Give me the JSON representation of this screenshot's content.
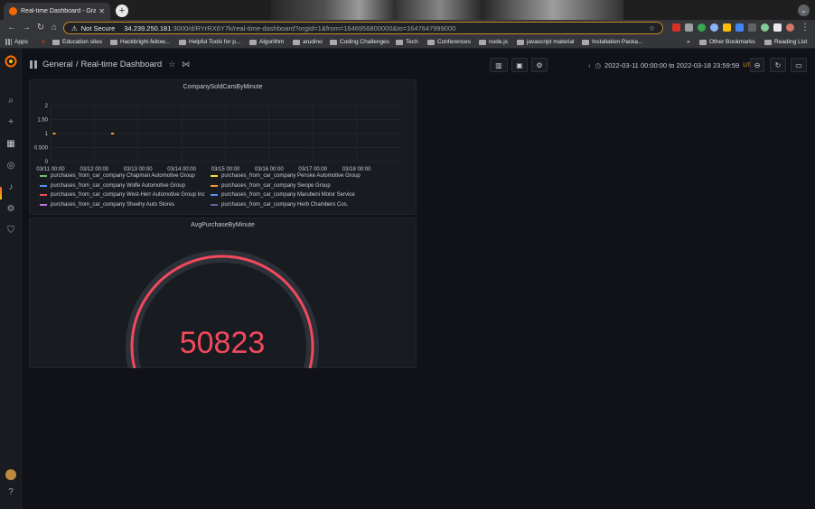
{
  "browser": {
    "tab_title": "Real-time Dashboard - Grafan",
    "tab_close": "✕",
    "new_tab": "+",
    "security": "Not Secure",
    "url_host": "34.239.250.181",
    "url_path": ":3000/d/RYrRX6Y7k/real-time-dashboard?orgId=1&from=1646956800000&to=1647647999000",
    "bookmarks": [
      "Apps",
      "Education sites",
      "Hackbright-fellow...",
      "Helpful Tools for p...",
      "Algorithm",
      "arudino",
      "Coding Challenges",
      "Tech",
      "Conferences",
      "node.js",
      "javascript material",
      "Installation Packa..."
    ],
    "bookmarks_more": "»",
    "other_bookmarks": "Other Bookmarks",
    "reading_list": "Reading List"
  },
  "dashboard": {
    "folder": "General",
    "separator": "/",
    "title": "Real-time Dashboard",
    "time_range": "2022-03-11 00:00:00 to 2022-03-18 23:59:59",
    "timezone": "UTC"
  },
  "panels": {
    "cars": {
      "title": "CompanySoldCarsByMinute"
    },
    "gauge": {
      "title": "AvgPurchaseByMinute",
      "value": "50823",
      "fill_fraction": 1.0,
      "color": "#f2495c"
    }
  },
  "chart_data": {
    "type": "scatter",
    "title": "CompanySoldCarsByMinute",
    "x_ticks": [
      "03/11 00:00",
      "03/12 00:00",
      "03/13 00:00",
      "03/14 00:00",
      "03/15 00:00",
      "03/16 00:00",
      "03/17 00:00",
      "03/18 00:00"
    ],
    "y_ticks": [
      "0",
      "0.500",
      "1",
      "1.50",
      "2"
    ],
    "ylim": [
      0,
      2
    ],
    "grid": true,
    "legend_position": "bottom",
    "series": [
      {
        "name": "purchases_from_car_company Chapman Automotive Group",
        "color": "#73bf69",
        "points": [
          {
            "x": "03/11 02:00",
            "y": 1
          }
        ]
      },
      {
        "name": "purchases_from_car_company Penske Automotive Group",
        "color": "#fade2a",
        "points": [
          {
            "x": "03/12 10:00",
            "y": 1
          }
        ]
      },
      {
        "name": "purchases_from_car_company Wolfe Automotive Group",
        "color": "#5794f2",
        "points": []
      },
      {
        "name": "purchases_from_car_company Swope Group",
        "color": "#ff9830",
        "points": [
          {
            "x": "03/11 02:00",
            "y": 1
          },
          {
            "x": "03/12 10:00",
            "y": 1
          }
        ]
      },
      {
        "name": "purchases_from_car_company West-Herr Automotive Group Inc",
        "color": "#f2495c",
        "points": []
      },
      {
        "name": "purchases_from_car_company Marubeni Motor Service",
        "color": "#5794f2",
        "points": []
      },
      {
        "name": "purchases_from_car_company Sheehy Auto Stores",
        "color": "#b877d9",
        "points": []
      },
      {
        "name": "purchases_from_car_company Herb Chambers Cos.",
        "color": "#705da0",
        "points": []
      }
    ]
  }
}
